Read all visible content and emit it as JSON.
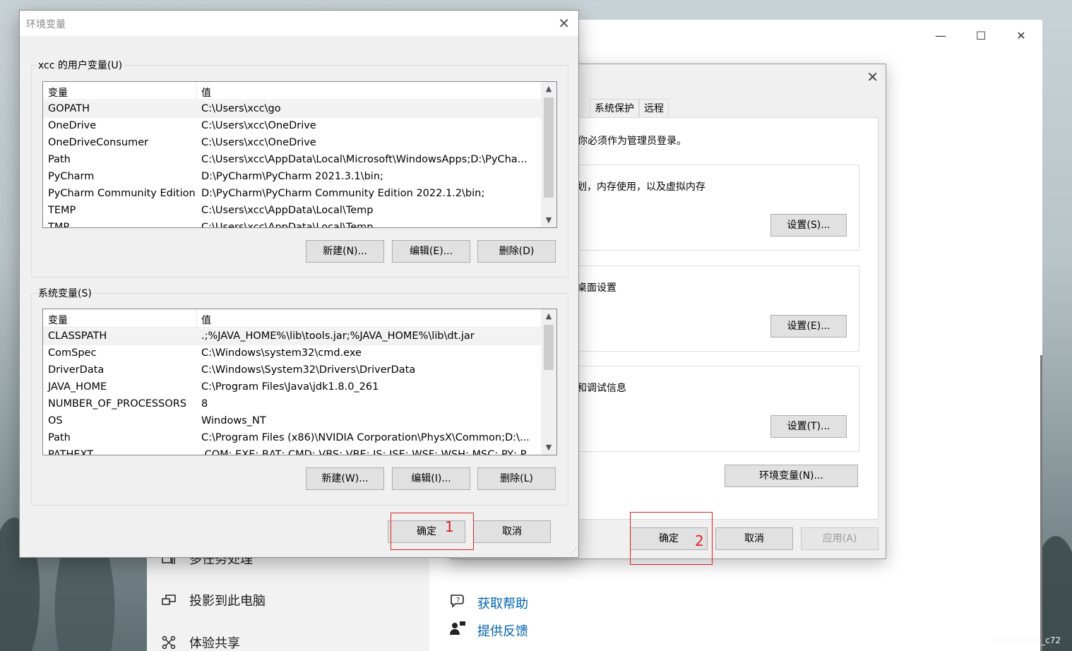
{
  "settings": {
    "side_items": [
      {
        "label": "多任务处理",
        "icon": "multitask-icon"
      },
      {
        "label": "投影到此电脑",
        "icon": "project-icon"
      },
      {
        "label": "体验共享",
        "icon": "share-icon"
      }
    ],
    "links": [
      {
        "label": "获取帮助",
        "icon": "help-icon"
      },
      {
        "label": "提供反馈",
        "icon": "feedback-icon"
      }
    ],
    "controls": {
      "minimize": "—",
      "maximize": "☐",
      "close": "✕"
    }
  },
  "sysprop": {
    "close": "✕",
    "tabs": [
      "系统保护",
      "远程"
    ],
    "admin_note": "你必须作为管理员登录。",
    "groups": [
      {
        "text": "划，内存使用，以及虚拟内存",
        "button": "设置(S)..."
      },
      {
        "text": "桌面设置",
        "button": "设置(E)..."
      },
      {
        "text": "和调试信息",
        "button": "设置(T)..."
      }
    ],
    "env_button": "环境变量(N)...",
    "ok": "确定",
    "cancel": "取消",
    "apply": "应用(A)"
  },
  "env": {
    "title": "环境变量",
    "close": "✕",
    "user_section": "xcc 的用户变量(U)",
    "system_section": "系统变量(S)",
    "col_var": "变量",
    "col_val": "值",
    "user_vars": [
      {
        "name": "GOPATH",
        "value": "C:\\Users\\xcc\\go"
      },
      {
        "name": "OneDrive",
        "value": "C:\\Users\\xcc\\OneDrive"
      },
      {
        "name": "OneDriveConsumer",
        "value": "C:\\Users\\xcc\\OneDrive"
      },
      {
        "name": "Path",
        "value": "C:\\Users\\xcc\\AppData\\Local\\Microsoft\\WindowsApps;D:\\PyCha..."
      },
      {
        "name": "PyCharm",
        "value": "D:\\PyCharm\\PyCharm 2021.3.1\\bin;"
      },
      {
        "name": "PyCharm Community Edition",
        "value": "D:\\PyCharm\\PyCharm Community Edition 2022.1.2\\bin;"
      },
      {
        "name": "TEMP",
        "value": "C:\\Users\\xcc\\AppData\\Local\\Temp"
      },
      {
        "name": "TMP",
        "value": "C:\\Users\\xcc\\AppData\\Local\\Temp"
      }
    ],
    "system_vars": [
      {
        "name": "CLASSPATH",
        "value": ".;%JAVA_HOME%\\lib\\tools.jar;%JAVA_HOME%\\lib\\dt.jar"
      },
      {
        "name": "ComSpec",
        "value": "C:\\Windows\\system32\\cmd.exe"
      },
      {
        "name": "DriverData",
        "value": "C:\\Windows\\System32\\Drivers\\DriverData"
      },
      {
        "name": "JAVA_HOME",
        "value": "C:\\Program Files\\Java\\jdk1.8.0_261"
      },
      {
        "name": "NUMBER_OF_PROCESSORS",
        "value": "8"
      },
      {
        "name": "OS",
        "value": "Windows_NT"
      },
      {
        "name": "Path",
        "value": "C:\\Program Files (x86)\\NVIDIA Corporation\\PhysX\\Common;D:\\..."
      },
      {
        "name": "PATHEXT",
        "value": ".COM;.EXE;.BAT;.CMD;.VBS;.VBE;.JS;.JSE;.WSF;.WSH;.MSC;.PY;.PYW"
      }
    ],
    "user_buttons": [
      "新建(N)...",
      "编辑(E)...",
      "删除(D)"
    ],
    "system_buttons": [
      "新建(W)...",
      "编辑(I)...",
      "删除(L)"
    ],
    "ok": "确定",
    "cancel": "取消"
  },
  "annotations": {
    "n1": "1",
    "n2": "2",
    "color": "#e02020"
  },
  "watermark": "CSDN @joe_c72"
}
